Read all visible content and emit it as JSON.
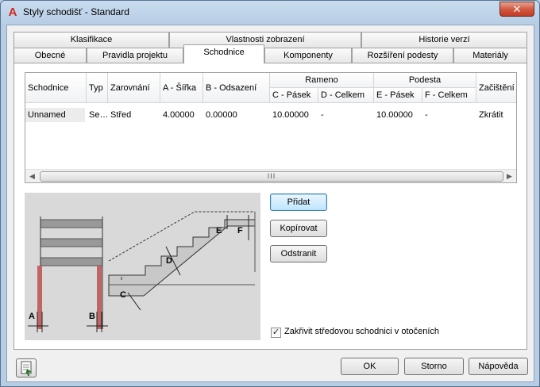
{
  "window": {
    "title": "Styly schodišť - Standard",
    "app_icon": "A",
    "close_glyph": "✕"
  },
  "tabs_row1": [
    {
      "label": "Klasifikace"
    },
    {
      "label": "Vlastnosti zobrazení"
    },
    {
      "label": "Historie verzí"
    }
  ],
  "tabs_row2": [
    {
      "label": "Obecné"
    },
    {
      "label": "Pravidla projektu"
    },
    {
      "label": "Schodnice"
    },
    {
      "label": "Komponenty"
    },
    {
      "label": "Rozšíření podesty"
    },
    {
      "label": "Materiály"
    }
  ],
  "active_tab": "Schodnice",
  "grid": {
    "headers": {
      "schodnice": "Schodnice",
      "typ": "Typ",
      "zarovnani": "Zarovnání",
      "a_sirka": "A - Šířka",
      "b_odsazeni": "B - Odsazení",
      "rameno": "Rameno",
      "c_pasek": "C - Pásek",
      "d_celkem": "D - Celkem",
      "podesta": "Podesta",
      "e_pasek": "E - Pásek",
      "f_celkem": "F - Celkem",
      "zacisteni": "Začištění"
    },
    "row": {
      "schodnice": "Unnamed",
      "typ": "Se…",
      "zarovnani": "Střed",
      "a_sirka": "4.00000",
      "b_odsazeni": "0.00000",
      "c_pasek": "10.00000",
      "d_celkem": "-",
      "e_pasek": "10.00000",
      "f_celkem": "-",
      "zacisteni": "Zkrátit"
    },
    "scroll_grip": "III"
  },
  "diagram_labels": {
    "a": "A",
    "b": "B",
    "c": "C",
    "d": "D",
    "e": "E",
    "f": "F"
  },
  "buttons": {
    "add": "Přidat",
    "copy": "Kopírovat",
    "remove": "Odstranit",
    "ok": "OK",
    "cancel": "Storno",
    "help": "Nápověda"
  },
  "checkbox": {
    "label": "Zakřivit středovou schodnici v otočeních",
    "checked_glyph": "✓"
  }
}
